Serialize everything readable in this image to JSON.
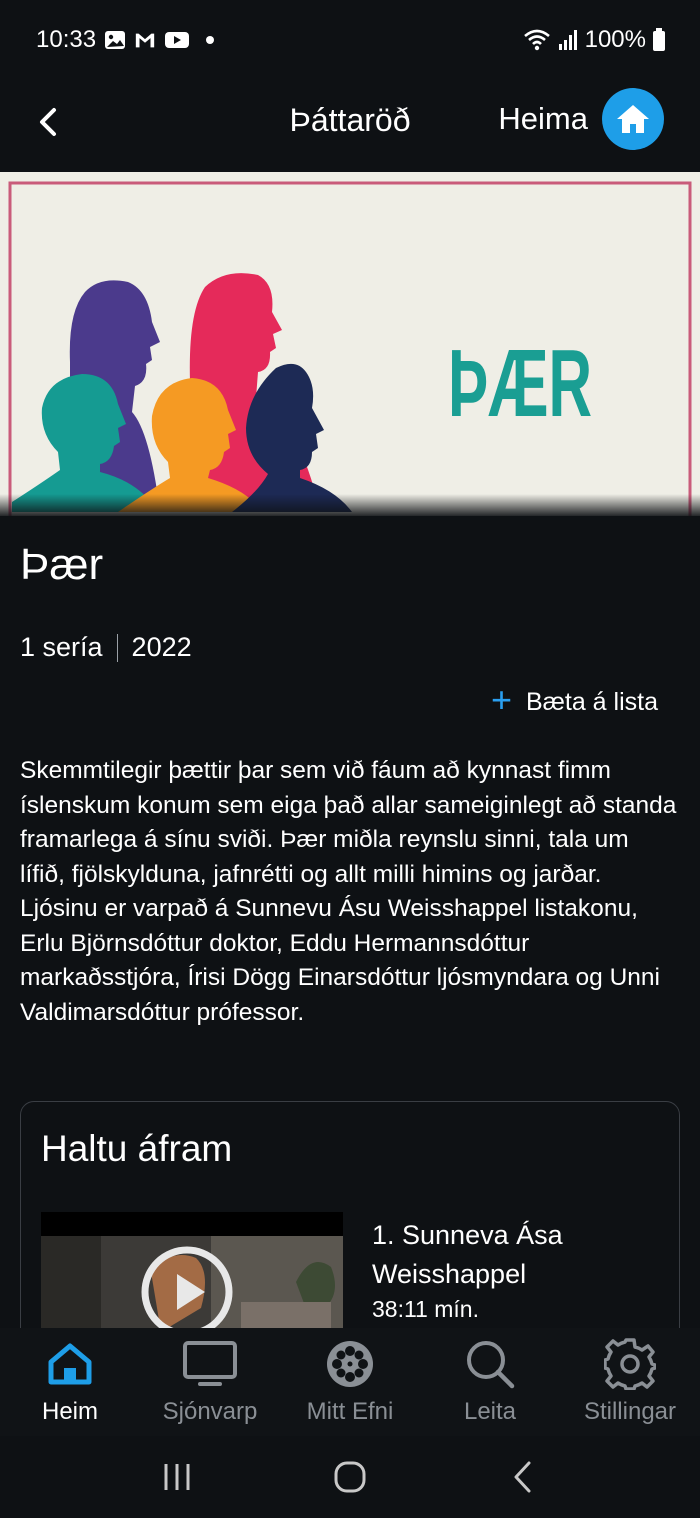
{
  "status_bar": {
    "time": "10:33",
    "battery": "100%",
    "icons": [
      "gallery-icon",
      "gmail-icon",
      "youtube-icon",
      "notification-dot",
      "wifi-icon",
      "signal-icon",
      "battery-icon"
    ]
  },
  "top_bar": {
    "title": "Þáttaröð",
    "home_label": "Heima",
    "accent_color": "#1e9ee8"
  },
  "hero": {
    "logo_text": "ÞÆR",
    "logo_color": "#1a9e93"
  },
  "show": {
    "title": "Þær",
    "seasons": "1 sería",
    "year": "2022",
    "add_to_list": "Bæta á lista",
    "description": "Skemmtilegir þættir þar sem við fáum að kynnast fimm íslenskum konum sem eiga það allar sameiginlegt að standa framarlega á sínu sviði. Þær miðla reynslu sinni, tala um lífið, fjölskylduna, jafnrétti og allt milli himins og jarðar. Ljósinu er varpað á Sunnevu Ásu Weisshappel listakonu, Erlu Björnsdóttur doktor, Eddu Hermannsdóttur markaðsstjóra, Írisi Dögg Einarsdóttur ljósmyndara og Unni Valdimarsdóttur prófessor."
  },
  "continue_watching": {
    "heading": "Haltu áfram",
    "episode_title": "1. Sunneva Ása Weisshappel",
    "episode_duration": "38:11 mín."
  },
  "bottom_nav": {
    "items": [
      {
        "label": "Heim",
        "icon": "home-icon",
        "active": true
      },
      {
        "label": "Sjónvarp",
        "icon": "tv-icon",
        "active": false
      },
      {
        "label": "Mitt Efni",
        "icon": "film-reel-icon",
        "active": false
      },
      {
        "label": "Leita",
        "icon": "search-icon",
        "active": false
      },
      {
        "label": "Stillingar",
        "icon": "gear-icon",
        "active": false
      }
    ],
    "active_color": "#1e9ee8"
  }
}
